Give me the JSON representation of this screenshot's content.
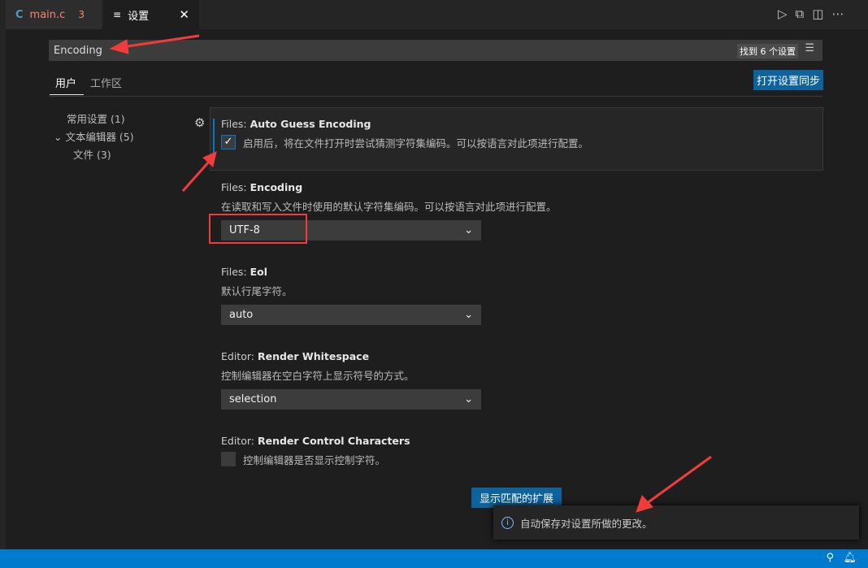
{
  "tabs": [
    {
      "icon": "C",
      "label": "main.c",
      "badge": "3"
    },
    {
      "icon": "settings-icon",
      "label": "设置"
    }
  ],
  "search": {
    "value": "Encoding",
    "result_count": "找到 6 个设置"
  },
  "scope_tabs": [
    "用户",
    "工作区"
  ],
  "sync_button": "打开设置同步",
  "toc": [
    "常用设置 (1)",
    "文本编辑器 (5)",
    "文件 (3)"
  ],
  "settings": [
    {
      "category": "Files: ",
      "name": "Auto Guess Encoding",
      "desc": "启用后，将在文件打开时尝试猜测字符集编码。可以按语言对此项进行配置。",
      "checked": true
    },
    {
      "category": "Files: ",
      "name": "Encoding",
      "desc": "在读取和写入文件时使用的默认字符集编码。可以按语言对此项进行配置。",
      "value": "UTF-8"
    },
    {
      "category": "Files: ",
      "name": "Eol",
      "desc": "默认行尾字符。",
      "value": "auto"
    },
    {
      "category": "Editor: ",
      "name": "Render Whitespace",
      "desc": "控制编辑器在空白字符上显示符号的方式。",
      "value": "selection"
    },
    {
      "category": "Editor: ",
      "name": "Render Control Characters",
      "desc": "控制编辑器是否显示控制字符。",
      "checked": false
    }
  ],
  "show_extensions_button": "显示匹配的扩展",
  "notification": "自动保存对设置所做的更改。",
  "colors": {
    "accent": "#007acc",
    "button": "#0e639c",
    "annotation": "#f03c3c"
  }
}
